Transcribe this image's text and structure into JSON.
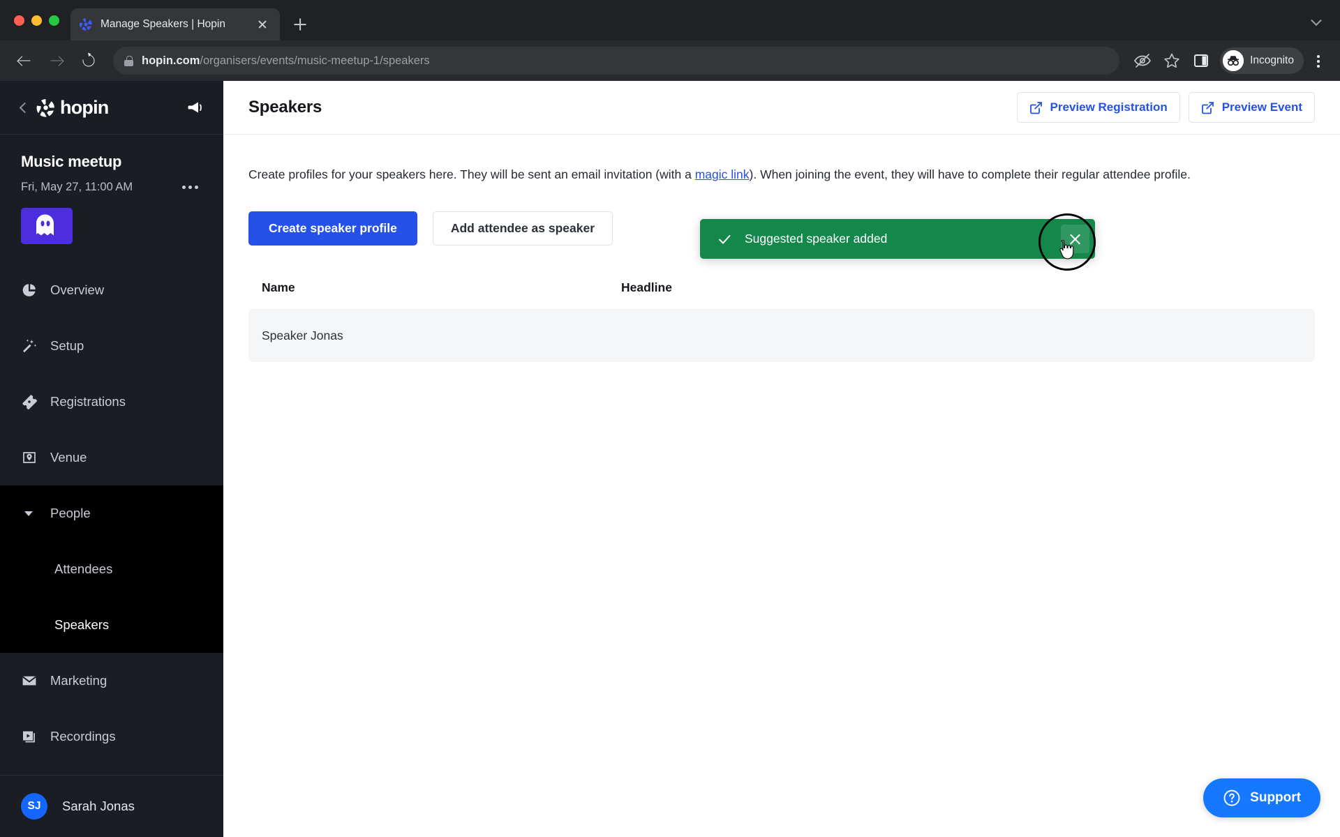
{
  "browser": {
    "tab": {
      "title": "Manage Speakers | Hopin",
      "favicon_name": "hopin-favicon"
    },
    "new_tab_label": "+",
    "url": {
      "host": "hopin.com",
      "path": "/organisers/events/music-meetup-1/speakers"
    },
    "profile_label": "Incognito",
    "icons": [
      "eye-slash-icon",
      "star-icon",
      "side-panel-icon",
      "incognito-avatar-icon",
      "kebab-menu-icon"
    ]
  },
  "sidebar": {
    "brand": "hopin",
    "back_label": "",
    "event": {
      "name": "Music meetup",
      "date": "Fri, May 27, 11:00 AM",
      "thumb_alt": "event-thumbnail"
    },
    "items": [
      {
        "label": "Overview",
        "icon": "pie-chart-icon"
      },
      {
        "label": "Setup",
        "icon": "magic-wand-icon"
      },
      {
        "label": "Registrations",
        "icon": "ticket-icon"
      },
      {
        "label": "Venue",
        "icon": "venue-pin-icon"
      }
    ],
    "group": {
      "label": "People",
      "children": [
        {
          "label": "Attendees",
          "active": false
        },
        {
          "label": "Speakers",
          "active": true
        }
      ]
    },
    "items_after": [
      {
        "label": "Marketing",
        "icon": "envelope-icon"
      },
      {
        "label": "Recordings",
        "icon": "recordings-icon"
      }
    ],
    "user": {
      "initials": "SJ",
      "name": "Sarah Jonas"
    }
  },
  "header": {
    "title": "Speakers",
    "preview_registration": "Preview Registration",
    "preview_event": "Preview Event"
  },
  "content": {
    "lead_part1": "Create profiles for your speakers here. They will be sent an email invitation (with a ",
    "lead_link": "magic link",
    "lead_part2": "). When joining the event, they will have to complete their regular attendee profile.",
    "create_speaker_profile": "Create speaker profile",
    "add_attendee_as_speaker": "Add attendee as speaker",
    "table": {
      "columns": [
        "Name",
        "Headline"
      ],
      "rows": [
        {
          "name": "Speaker Jonas",
          "headline": ""
        }
      ]
    }
  },
  "toast": {
    "message": "Suggested speaker added",
    "close_label": "",
    "color": "#13884a"
  },
  "support": {
    "label": "Support"
  },
  "colors": {
    "accent_blue": "#2551e8",
    "support_blue": "#1677ff",
    "toast_green": "#13884a",
    "sidebar_bg": "#1b1d24",
    "sidebar_active_bg": "#000000"
  }
}
